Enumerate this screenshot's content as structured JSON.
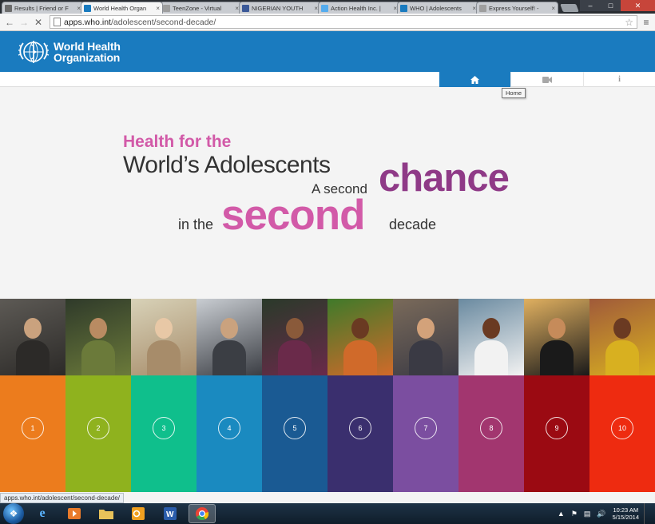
{
  "browser": {
    "tabs": [
      {
        "title": "Results | Friend or F",
        "fav_color": "#6b6b6b",
        "active": false
      },
      {
        "title": "World Health Organ",
        "fav_color": "#1a7bbf",
        "active": true
      },
      {
        "title": "TeenZone - Virtual",
        "fav_color": "#9e9e9e",
        "active": false
      },
      {
        "title": "NIGERIAN YOUTH",
        "fav_color": "#3b5998",
        "active": false
      },
      {
        "title": "Action Health Inc. |",
        "fav_color": "#55acee",
        "active": false
      },
      {
        "title": "WHO | Adolescents",
        "fav_color": "#1a7bbf",
        "active": false
      },
      {
        "title": "Express Yourself! -",
        "fav_color": "#9e9e9e",
        "active": false
      }
    ],
    "url_host": "apps.who.int",
    "url_path": "/adolescent/second-decade/",
    "status_url": "apps.who.int/adolescent/second-decade/"
  },
  "who": {
    "name_line1": "World Health",
    "name_line2": "Organization"
  },
  "nav": {
    "home_icon": "home-icon",
    "video_icon": "video-camera-icon",
    "info_icon": "info-icon",
    "tooltip": "Home"
  },
  "hero": {
    "line1": "Health for the",
    "line2": "World’s Adolescents",
    "line3": "A second",
    "line4": "chance",
    "line5": "in the",
    "line6": "second",
    "line7": "decade"
  },
  "chapters": [
    {
      "num": "1",
      "color": "#ec7c1d"
    },
    {
      "num": "2",
      "color": "#8fb21e"
    },
    {
      "num": "3",
      "color": "#0fbf8c"
    },
    {
      "num": "4",
      "color": "#1a8ac0"
    },
    {
      "num": "5",
      "color": "#1a5a93"
    },
    {
      "num": "6",
      "color": "#3a2f6e"
    },
    {
      "num": "7",
      "color": "#7b4ea0"
    },
    {
      "num": "8",
      "color": "#a2366f"
    },
    {
      "num": "9",
      "color": "#9b0a12"
    },
    {
      "num": "10",
      "color": "#ee2b10"
    }
  ],
  "taskbar": {
    "time": "10:23 AM",
    "date": "5/15/2014",
    "apps": [
      "internet-explorer",
      "media-player",
      "file-explorer",
      "outlook",
      "word",
      "chrome"
    ]
  }
}
